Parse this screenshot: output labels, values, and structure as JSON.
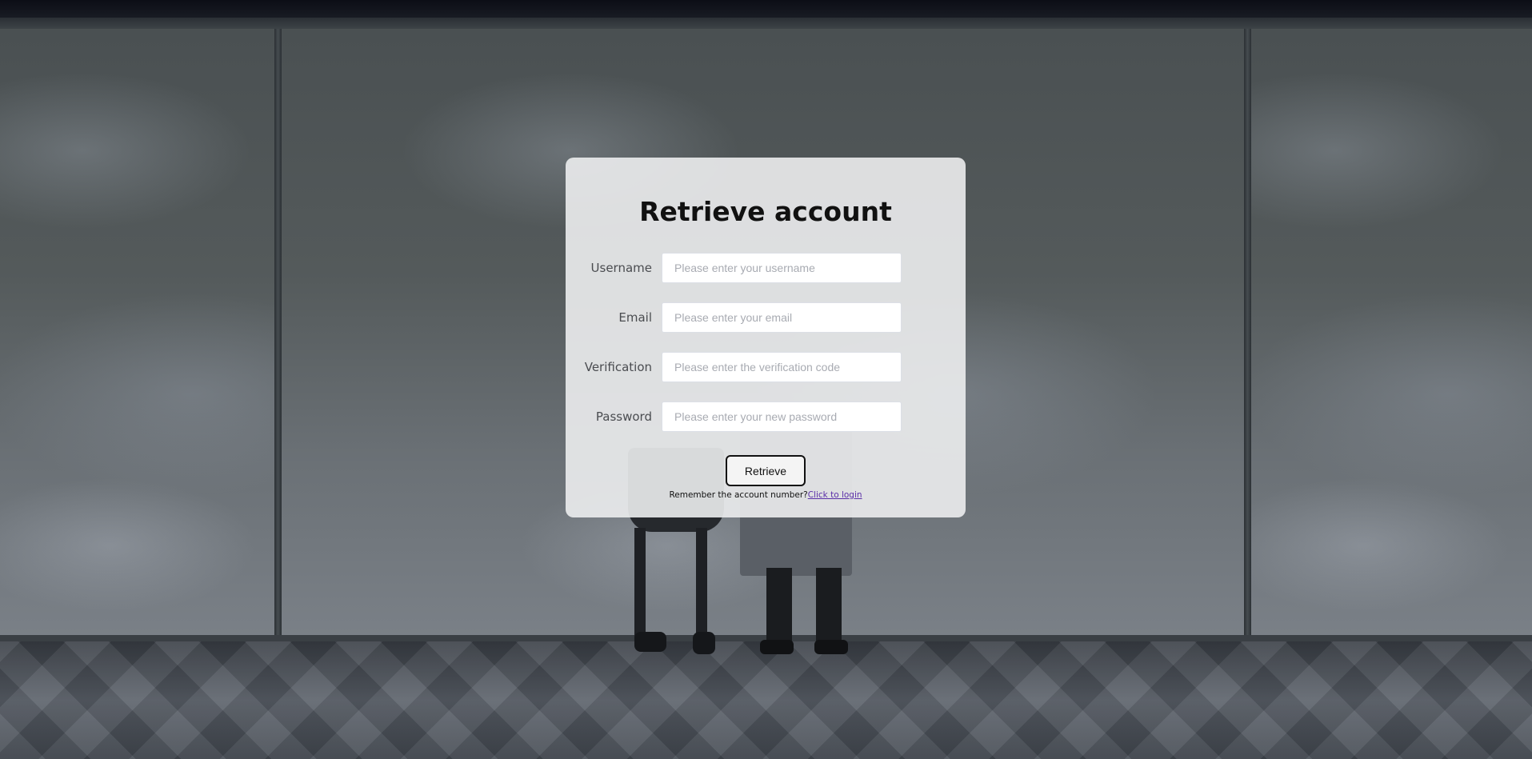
{
  "form": {
    "title": "Retrieve account",
    "fields": [
      {
        "label": "Username",
        "placeholder": "Please enter your username",
        "value": ""
      },
      {
        "label": "Email",
        "placeholder": "Please enter your email",
        "value": ""
      },
      {
        "label": "Verification",
        "placeholder": "Please enter the verification code",
        "value": ""
      },
      {
        "label": "Password",
        "placeholder": "Please enter your new password",
        "value": ""
      }
    ],
    "submit_label": "Retrieve",
    "footer_text": "Remember the account number?",
    "login_link": "Click to login"
  },
  "colors": {
    "card_background": "#ecedee",
    "link": "#5b2fa8",
    "button_border": "#111111"
  }
}
